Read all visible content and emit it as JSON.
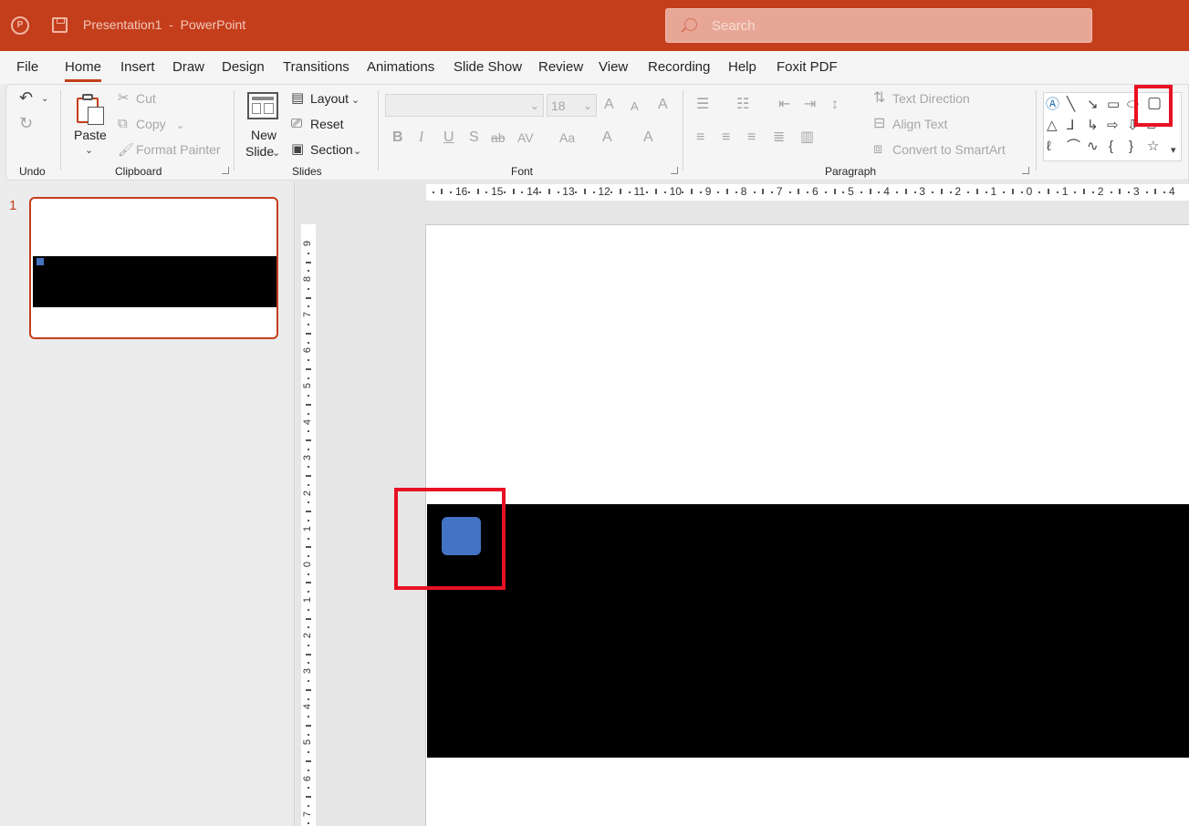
{
  "titlebar": {
    "doc_title": "Presentation1  -  PowerPoint",
    "search_placeholder": "Search",
    "brand_color": "#c43e1c"
  },
  "menu": {
    "tabs": [
      "File",
      "Home",
      "Insert",
      "Draw",
      "Design",
      "Transitions",
      "Animations",
      "Slide Show",
      "Review",
      "View",
      "Recording",
      "Help",
      "Foxit PDF"
    ],
    "active": "Home"
  },
  "ribbon": {
    "undo": {
      "group_label": "Undo"
    },
    "clipboard": {
      "group_label": "Clipboard",
      "paste": "Paste",
      "cut": "Cut",
      "copy": "Copy",
      "format_painter": "Format Painter"
    },
    "slides": {
      "group_label": "Slides",
      "new_slide_line1": "New",
      "new_slide_line2": "Slide",
      "layout": "Layout",
      "reset": "Reset",
      "section": "Section"
    },
    "font": {
      "group_label": "Font",
      "font_name": "",
      "font_size": "18",
      "bold": "B",
      "italic": "I",
      "underline": "U",
      "shadow": "S",
      "strike": "ab",
      "spacing": "AV",
      "case": "Aa",
      "grow": "A",
      "shrink": "A",
      "clear": "A",
      "highlight": "A",
      "color": "A"
    },
    "paragraph": {
      "group_label": "Paragraph",
      "text_direction": "Text Direction",
      "align_text": "Align Text",
      "convert_smartart": "Convert to SmartArt"
    }
  },
  "slides_pane": {
    "slide_number": "1"
  },
  "rulers": {
    "horizontal": [
      "16",
      "15",
      "14",
      "13",
      "12",
      "11",
      "10",
      "9",
      "8",
      "7",
      "6",
      "5",
      "4",
      "3",
      "2",
      "1",
      "0",
      "1",
      "2",
      "3",
      "4"
    ],
    "vertical": [
      "9",
      "8",
      "7",
      "6",
      "5",
      "4",
      "3",
      "2",
      "1",
      "0",
      "1",
      "2",
      "3",
      "4",
      "5",
      "6",
      "7"
    ]
  },
  "slide": {
    "band_color": "#000000",
    "shape_color": "#4472c4",
    "shape_type": "rounded-rectangle"
  },
  "highlight_color": "#e81123"
}
